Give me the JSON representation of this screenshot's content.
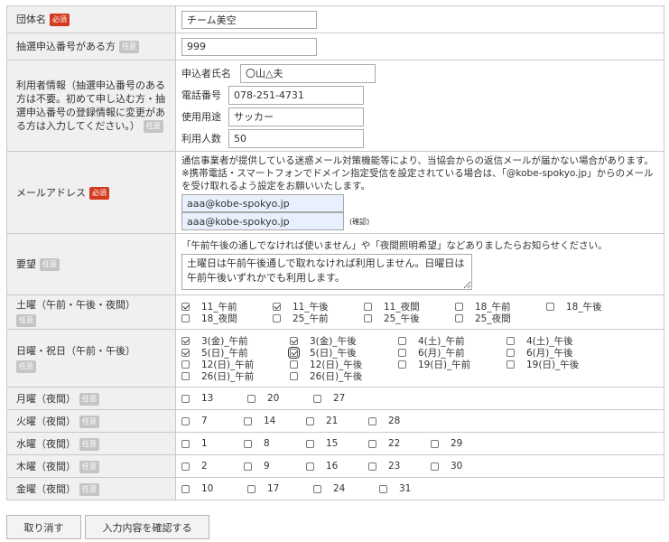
{
  "badges": {
    "required": "必須",
    "optional": "任意"
  },
  "group": {
    "label": "団体名",
    "value": "チーム美空"
  },
  "lottery": {
    "label": "抽選申込番号がある方",
    "value": "999"
  },
  "user_info": {
    "label": "利用者情報（抽選申込番号のある方は不要。初めて申し込む方・抽選申込番号の登録情報に変更がある方は入力してください。）",
    "name_label": "申込者氏名",
    "name_value": "〇山△夫",
    "phone_label": "電話番号",
    "phone_value": "078-251-4731",
    "purpose_label": "使用用途",
    "purpose_value": "サッカー",
    "count_label": "利用人数",
    "count_value": "50"
  },
  "email": {
    "label": "メールアドレス",
    "notice_line1": "通信事業者が提供している迷惑メール対策機能等により、当協会からの返信メールが届かない場合があります。",
    "notice_line2": "※携帯電話・スマートフォンでドメイン指定受信を設定されている場合は、「@kobe-spokyo.jp」からのメール",
    "notice_line3": "を受け取れるよう設定をお願いいたします。",
    "value": "aaa@kobe-spokyo.jp",
    "confirm_value": "aaa@kobe-spokyo.jp",
    "confirm_label": "(確認)"
  },
  "request": {
    "label": "要望",
    "notice": "「午前午後の通しでなければ使いません」や「夜間照明希望」などありましたらお知らせください。",
    "value": "土曜日は午前午後通しで取れなければ利用しません。日曜日は午前午後いずれかでも利用します。"
  },
  "saturday": {
    "label": "土曜（午前・午後・夜間）",
    "items": [
      {
        "label": "11_午前",
        "checked": true
      },
      {
        "label": "11_午後",
        "checked": true
      },
      {
        "label": "11_夜間",
        "checked": false
      },
      {
        "label": "18_午前",
        "checked": false
      },
      {
        "label": "18_午後",
        "checked": false
      },
      {
        "label": "18_夜間",
        "checked": false
      },
      {
        "label": "25_午前",
        "checked": false
      },
      {
        "label": "25_午後",
        "checked": false
      },
      {
        "label": "25_夜間",
        "checked": false
      }
    ]
  },
  "sunday": {
    "label": "日曜・祝日（午前・午後）",
    "items": [
      {
        "label": "3(金)_午前",
        "checked": true
      },
      {
        "label": "3(金)_午後",
        "checked": true
      },
      {
        "label": "4(土)_午前",
        "checked": false
      },
      {
        "label": "4(土)_午後",
        "checked": false
      },
      {
        "label": "5(日)_午前",
        "checked": true
      },
      {
        "label": "5(日)_午後",
        "checked": true
      },
      {
        "label": "6(月)_午前",
        "checked": false
      },
      {
        "label": "6(月)_午後",
        "checked": false
      },
      {
        "label": "12(日)_午前",
        "checked": false
      },
      {
        "label": "12(日)_午後",
        "checked": false
      },
      {
        "label": "19(日)_午前",
        "checked": false
      },
      {
        "label": "19(日)_午後",
        "checked": false
      },
      {
        "label": "26(日)_午前",
        "checked": false
      },
      {
        "label": "26(日)_午後",
        "checked": false
      }
    ]
  },
  "weekdays": [
    {
      "label": "月曜（夜間）",
      "days": [
        "13",
        "20",
        "27"
      ]
    },
    {
      "label": "火曜（夜間）",
      "days": [
        "7",
        "14",
        "21",
        "28"
      ]
    },
    {
      "label": "水曜（夜間）",
      "days": [
        "1",
        "8",
        "15",
        "22",
        "29"
      ]
    },
    {
      "label": "木曜（夜間）",
      "days": [
        "2",
        "9",
        "16",
        "23",
        "30"
      ]
    },
    {
      "label": "金曜（夜間）",
      "days": [
        "10",
        "17",
        "24",
        "31"
      ]
    }
  ],
  "buttons": {
    "cancel": "取り消す",
    "confirm": "入力内容を確認する"
  }
}
